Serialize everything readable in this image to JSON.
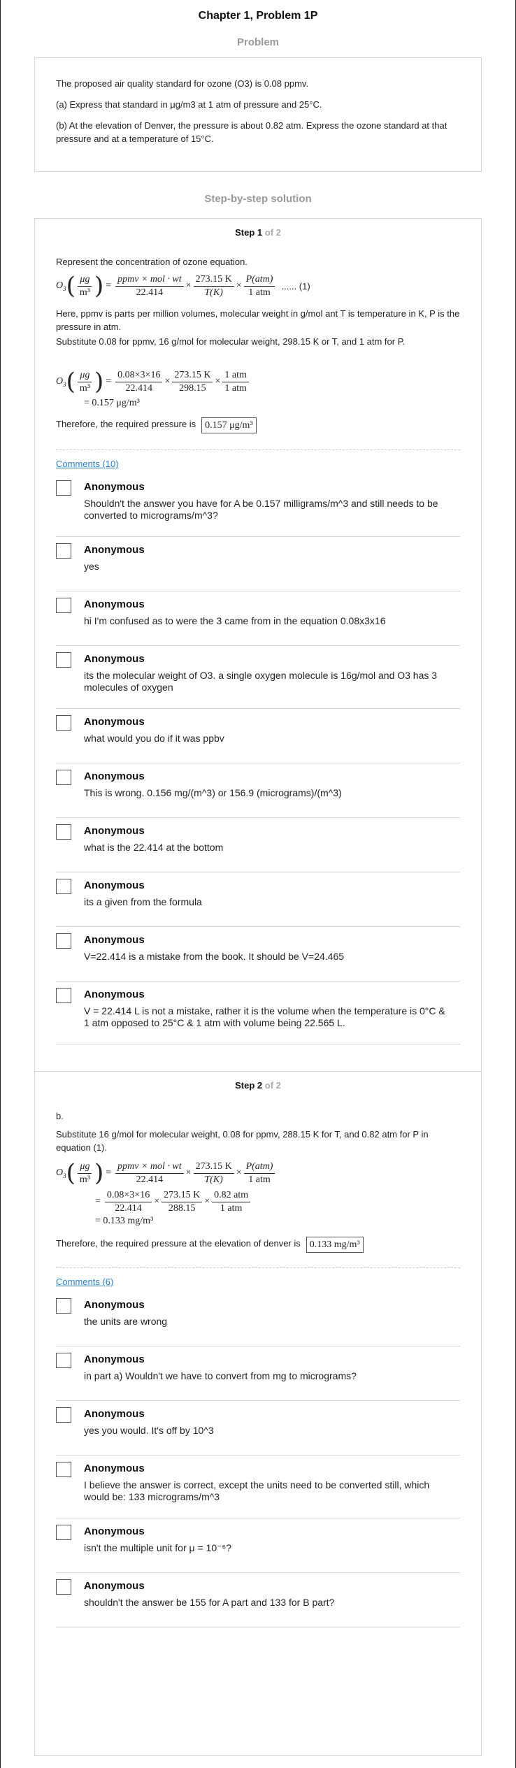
{
  "page_title": "Chapter 1, Problem 1P",
  "problem": {
    "heading": "Problem",
    "lines": [
      "The proposed air quality standard for ozone (O3) is 0.08 ppmv.",
      "(a) Express that standard in μg/m3 at 1 atm of pressure and 25°C.",
      "(b) At the elevation of Denver, the pressure is about 0.82 atm. Express the ozone standard at that pressure and at a temperature of 15°C."
    ]
  },
  "solution_heading": "Step-by-step solution",
  "step1": {
    "label": "Step 1",
    "of": "of 2",
    "intro": "Represent the concentration of ozone equation.",
    "eq_lhs_base": "O",
    "eq_lhs_sub": "3",
    "eq_lhs_unit_num": "μg",
    "eq_lhs_unit_den": "m³",
    "eq_f1_num": "ppmv × mol · wt",
    "eq_f1_den": "22.414",
    "eq_f2_num": "273.15 K",
    "eq_f2_den": "T(K)",
    "eq_f3_num": "P(atm)",
    "eq_f3_den": "1 atm",
    "eq_tag": "...... (1)",
    "note": "Here, ppmv is parts per million volumes, molecular weight in g/mol ant T is temperature in K, P is the pressure in atm.",
    "subst": "Substitute 0.08 for ppmv, 16 g/mol for molecular weight, 298.15 K or T, and 1 atm for P.",
    "calc_f1_num": "0.08×3×16",
    "calc_f1_den": "22.414",
    "calc_f2_num": "273.15 K",
    "calc_f2_den": "298.15",
    "calc_f3_num": "1 atm",
    "calc_f3_den": "1 atm",
    "calc_result": "= 0.157 μg/m³",
    "conclusion": "Therefore, the required pressure is",
    "answer": "0.157 μg/m³",
    "comments_label": "Comments (10)",
    "comments": [
      {
        "author": "Anonymous",
        "text": "Shouldn't the answer you have for A be 0.157 milligrams/m^3 and still needs to be converted to micrograms/m^3?"
      },
      {
        "author": "Anonymous",
        "text": "yes"
      },
      {
        "author": "Anonymous",
        "text": "hi I'm confused as to were the 3 came from in the equation 0.08x3x16"
      },
      {
        "author": "Anonymous",
        "text": "its the molecular weight of O3. a single oxygen molecule is 16g/mol and O3 has 3 molecules of oxygen"
      },
      {
        "author": "Anonymous",
        "text": "what would you do if it was ppbv"
      },
      {
        "author": "Anonymous",
        "text": "This is wrong. 0.156 mg/(m^3) or 156.9 (micrograms)/(m^3)"
      },
      {
        "author": "Anonymous",
        "text": "what is the 22.414 at the bottom"
      },
      {
        "author": "Anonymous",
        "text": "its a given from the formula"
      },
      {
        "author": "Anonymous",
        "text": "V=22.414 is a mistake from the book. It should be V=24.465"
      },
      {
        "author": "Anonymous",
        "text": "V = 22.414 L is not a mistake, rather it is the volume when the temperature is 0°C & 1 atm opposed to 25°C & 1 atm with volume being 22.565 L."
      }
    ]
  },
  "step2": {
    "label": "Step 2",
    "of": "of 2",
    "part": "b.",
    "subst": "Substitute 16 g/mol for molecular weight, 0.08 for ppmv, 288.15 K for T, and 0.82 atm for P in equation (1).",
    "calc_f1_num": "0.08×3×16",
    "calc_f1_den": "22.414",
    "calc_f2_num": "273.15 K",
    "calc_f2_den": "288.15",
    "calc_f3_num": "0.82 atm",
    "calc_f3_den": "1 atm",
    "calc_result": "= 0.133 mg/m³",
    "conclusion": "Therefore, the required pressure at the elevation of denver is",
    "answer": "0.133 mg/m³",
    "comments_label": "Comments (6)",
    "comments": [
      {
        "author": "Anonymous",
        "text": "the units are wrong"
      },
      {
        "author": "Anonymous",
        "text": "in part a) Wouldn't we have to convert from mg to micrograms?"
      },
      {
        "author": "Anonymous",
        "text": "yes you would. It's off by 10^3"
      },
      {
        "author": "Anonymous",
        "text": "I believe the answer is correct, except the units need to be converted still, which would be: 133 micrograms/m^3"
      },
      {
        "author": "Anonymous",
        "text": "isn't the multiple unit for μ = 10⁻⁶?"
      },
      {
        "author": "Anonymous",
        "text": "shouldn't the answer be 155 for A part and 133 for B part?"
      }
    ]
  }
}
